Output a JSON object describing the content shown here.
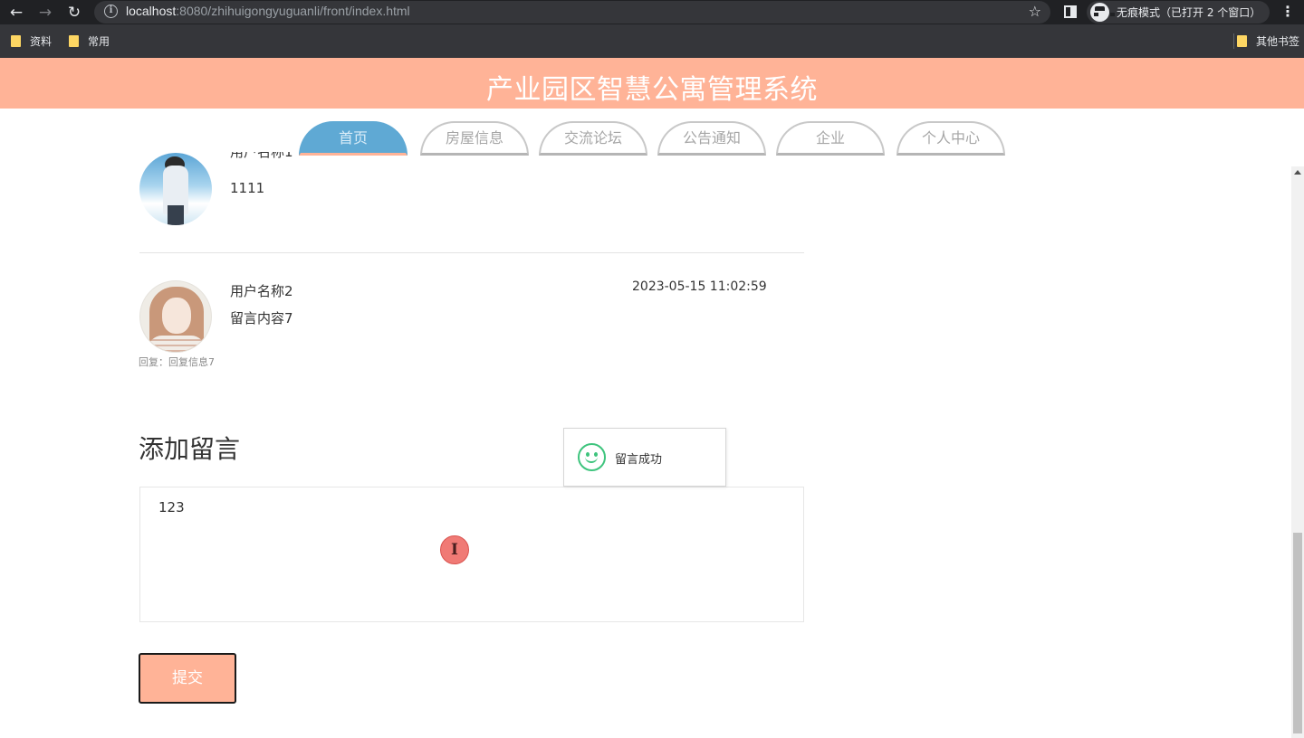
{
  "browser": {
    "url_host": "localhost",
    "url_rest": ":8080/zhihuigongyuguanli/front/index.html",
    "incognito_label": "无痕模式（已打开 2 个窗口）",
    "bookmarks": [
      "资料",
      "常用"
    ],
    "other_bookmarks": "其他书签"
  },
  "header": {
    "title": "产业园区智慧公寓管理系统",
    "bg_color": "#ffb397"
  },
  "nav": {
    "tabs": [
      {
        "label": "首页",
        "active": true
      },
      {
        "label": "房屋信息",
        "active": false
      },
      {
        "label": "交流论坛",
        "active": false
      },
      {
        "label": "公告通知",
        "active": false
      },
      {
        "label": "企业",
        "active": false
      },
      {
        "label": "个人中心",
        "active": false
      }
    ]
  },
  "comments": [
    {
      "user": "用户名称1",
      "content": "1111"
    },
    {
      "user": "用户名称2",
      "time": "2023-05-15 11:02:59",
      "content": "留言内容7",
      "reply": "回复：回复信息7"
    }
  ],
  "form": {
    "title": "添加留言",
    "textarea_value": "123",
    "submit_label": "提交"
  },
  "toast": {
    "message": "留言成功"
  },
  "cursor_glyph": "I"
}
